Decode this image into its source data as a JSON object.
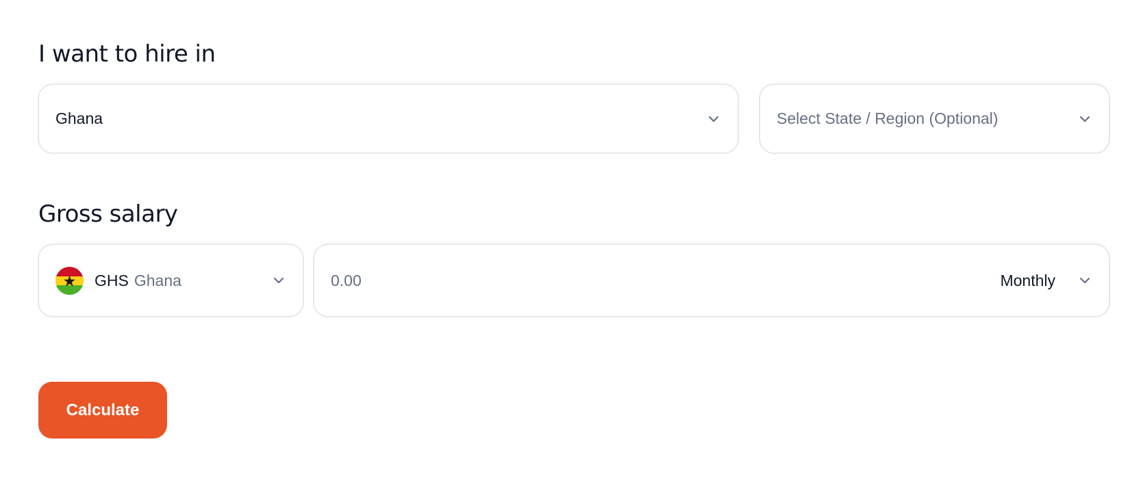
{
  "hire": {
    "title": "I want to hire in",
    "country": {
      "value": "Ghana",
      "icon": "chevron-down-icon"
    },
    "region": {
      "placeholder": "Select State / Region (Optional)",
      "icon": "chevron-down-icon"
    }
  },
  "salary": {
    "title": "Gross salary",
    "currency": {
      "flag": "ghana-flag-icon",
      "code": "GHS",
      "name": "Ghana",
      "icon": "chevron-down-icon"
    },
    "amount": {
      "placeholder": "0.00",
      "value": ""
    },
    "period": {
      "value": "Monthly",
      "icon": "chevron-down-icon"
    }
  },
  "actions": {
    "calculate_label": "Calculate"
  },
  "colors": {
    "accent": "#e95527",
    "text": "#101828",
    "muted": "#667085",
    "border": "#e4e7ec",
    "flag_red": "#ce1126",
    "flag_gold": "#fcd116",
    "flag_green": "#006b3f"
  }
}
